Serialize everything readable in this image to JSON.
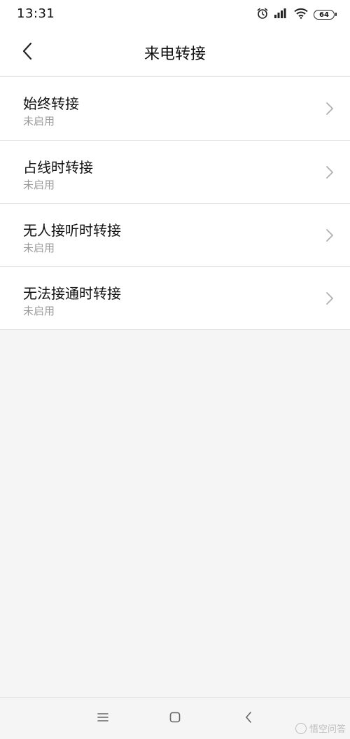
{
  "status_bar": {
    "time": "13:31",
    "battery": "64",
    "icons": [
      "alarm-icon",
      "signal-icon",
      "wifi-icon",
      "battery-icon"
    ]
  },
  "header": {
    "title": "来电转接",
    "back_icon": "chevron-left-icon"
  },
  "list": {
    "items": [
      {
        "title": "始终转接",
        "subtitle": "未启用"
      },
      {
        "title": "占线时转接",
        "subtitle": "未启用"
      },
      {
        "title": "无人接听时转接",
        "subtitle": "未启用"
      },
      {
        "title": "无法接通时转接",
        "subtitle": "未启用"
      }
    ]
  },
  "nav_bar": {
    "icons": [
      "menu-icon",
      "home-square-icon",
      "back-chevron-icon"
    ]
  },
  "watermark": {
    "text": "悟空问答"
  },
  "colors": {
    "background": "#f5f5f5",
    "surface": "#ffffff",
    "primary_text": "#111111",
    "secondary_text": "#9a9a9a",
    "divider": "#e6e6e6"
  }
}
